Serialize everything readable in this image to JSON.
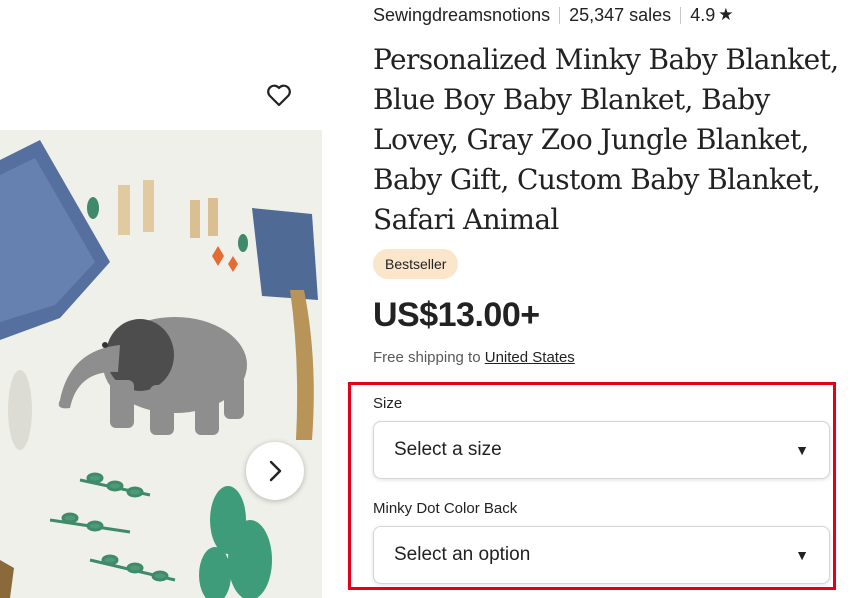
{
  "shop": {
    "name": "Sewingdreamsnotions",
    "sales": "25,347 sales",
    "rating": "4.9"
  },
  "listing": {
    "title": "Personalized Minky Baby Blanket, Blue Boy Baby Blanket, Baby Lovey, Gray Zoo Jungle Blanket, Baby Gift, Custom Baby Blanket, Safari Animal",
    "badge": "Bestseller",
    "price": "US$13.00+",
    "shipping_prefix": "Free shipping to",
    "shipping_destination": "United States"
  },
  "options": {
    "size": {
      "label": "Size",
      "placeholder": "Select a size"
    },
    "back_color": {
      "label": "Minky Dot Color Back",
      "placeholder": "Select an option"
    }
  },
  "icons": {
    "favorite": "heart-outline-icon",
    "next": "chevron-right-icon",
    "dropdown": "caret-down-icon",
    "rating": "star-icon"
  },
  "colors": {
    "badge_bg": "#fbe6cc",
    "highlight": "#e2001a",
    "text": "#222222"
  }
}
